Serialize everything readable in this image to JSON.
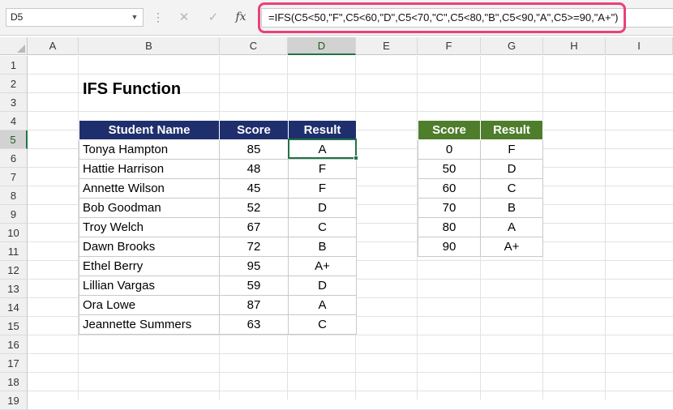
{
  "formula_bar": {
    "name_box": "D5",
    "cancel_icon": "✕",
    "enter_icon": "✓",
    "fx_label": "fx",
    "formula": "=IFS(C5<50,\"F\",C5<60,\"D\",C5<70,\"C\",C5<80,\"B\",C5<90,\"A\",C5>=90,\"A+\")"
  },
  "columns": [
    "A",
    "B",
    "C",
    "D",
    "E",
    "F",
    "G",
    "H",
    "I"
  ],
  "rows": [
    "1",
    "2",
    "3",
    "4",
    "5",
    "6",
    "7",
    "8",
    "9",
    "10",
    "11",
    "12",
    "13",
    "14",
    "15",
    "16",
    "17",
    "18",
    "19"
  ],
  "selected": {
    "column": "D",
    "row": "5"
  },
  "sheet_title": "IFS Function",
  "students_table": {
    "headers": [
      "Student Name",
      "Score",
      "Result"
    ],
    "header_color": "#1f2f6e",
    "rows": [
      [
        "Tonya Hampton",
        "85",
        "A"
      ],
      [
        "Hattie Harrison",
        "48",
        "F"
      ],
      [
        "Annette Wilson",
        "45",
        "F"
      ],
      [
        "Bob Goodman",
        "52",
        "D"
      ],
      [
        "Troy Welch",
        "67",
        "C"
      ],
      [
        "Dawn Brooks",
        "72",
        "B"
      ],
      [
        "Ethel Berry",
        "95",
        "A+"
      ],
      [
        "Lillian Vargas",
        "59",
        "D"
      ],
      [
        "Ora Lowe",
        "87",
        "A"
      ],
      [
        "Jeannette Summers",
        "63",
        "C"
      ]
    ]
  },
  "grade_table": {
    "headers": [
      "Score",
      "Result"
    ],
    "header_color": "#4e7d2c",
    "rows": [
      [
        "0",
        "F"
      ],
      [
        "50",
        "D"
      ],
      [
        "60",
        "C"
      ],
      [
        "70",
        "B"
      ],
      [
        "80",
        "A"
      ],
      [
        "90",
        "A+"
      ]
    ]
  },
  "highlight_color": "#e9417a",
  "selection_color": "#217346"
}
